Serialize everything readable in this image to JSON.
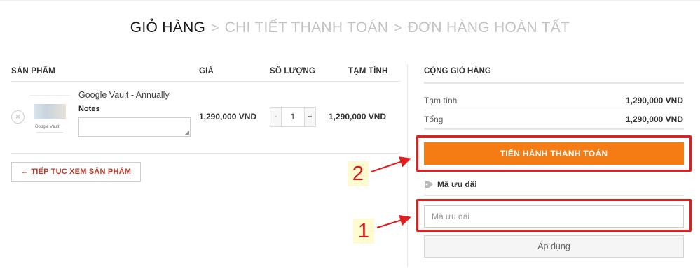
{
  "breadcrumb": {
    "step1": "GIỎ HÀNG",
    "step2": "CHI TIẾT THANH TOÁN",
    "step3": "ĐƠN HÀNG HOÀN TẤT",
    "separator": ">"
  },
  "cart": {
    "headers": {
      "product": "SẢN PHẨM",
      "price": "GIÁ",
      "quantity": "SỐ LƯỢNG",
      "subtotal": "TẠM TÍNH"
    },
    "items": [
      {
        "name": "Google Vault - Annually",
        "notes_label": "Notes",
        "notes_value": "",
        "thumbnail_caption": "Google Vault",
        "price": "1,290,000 VND",
        "quantity": "1",
        "subtotal": "1,290,000 VND"
      }
    ],
    "remove_symbol": "×",
    "qty_minus": "-",
    "qty_plus": "+",
    "continue_label": "← TIẾP TỤC XEM SẢN PHẨM"
  },
  "totals": {
    "title": "CỘNG GIỎ HÀNG",
    "subtotal_label": "Tạm tính",
    "subtotal_value": "1,290,000 VND",
    "total_label": "Tổng",
    "total_value": "1,290,000 VND",
    "checkout_label": "TIẾN HÀNH THANH TOÁN",
    "checkout_color": "#f57c14"
  },
  "coupon": {
    "title": "Mã ưu đãi",
    "icon": "tag-icon",
    "placeholder": "Mã ưu đãi",
    "apply_label": "Áp dụng"
  },
  "annotations": {
    "label_checkout": "2",
    "label_coupon": "1",
    "color": "#e21e1e"
  }
}
